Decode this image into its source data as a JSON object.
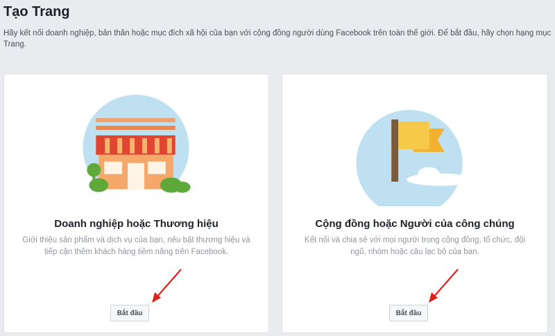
{
  "page": {
    "title": "Tạo Trang",
    "description": "Hãy kết nối doanh nghiệp, bản thân hoặc mục đích xã hội của bạn với cộng đồng người dùng Facebook trên toàn thế giới. Để bắt đầu, hãy chọn hạng mục Trang."
  },
  "cards": [
    {
      "title": "Doanh nghiệp hoặc Thương hiệu",
      "description": "Giới thiệu sản phẩm và dịch vụ của bạn, nêu bật thương hiệu và tiếp cận thêm khách hàng tiềm năng trên Facebook.",
      "button_label": "Bắt đầu",
      "illustration": "storefront-icon"
    },
    {
      "title": "Cộng đồng hoặc Người của công chúng",
      "description": "Kết nối và chia sẻ với mọi người trong cộng đồng, tổ chức, đội ngũ, nhóm hoặc câu lạc bộ của bạn.",
      "button_label": "Bắt đầu",
      "illustration": "flag-icon"
    }
  ],
  "colors": {
    "background": "#e9ebee",
    "circle": "#bfe0f0",
    "awning": "#e0452f",
    "building": "#f5a86a",
    "flag": "#f7c94a",
    "arrow": "#e0201b"
  }
}
